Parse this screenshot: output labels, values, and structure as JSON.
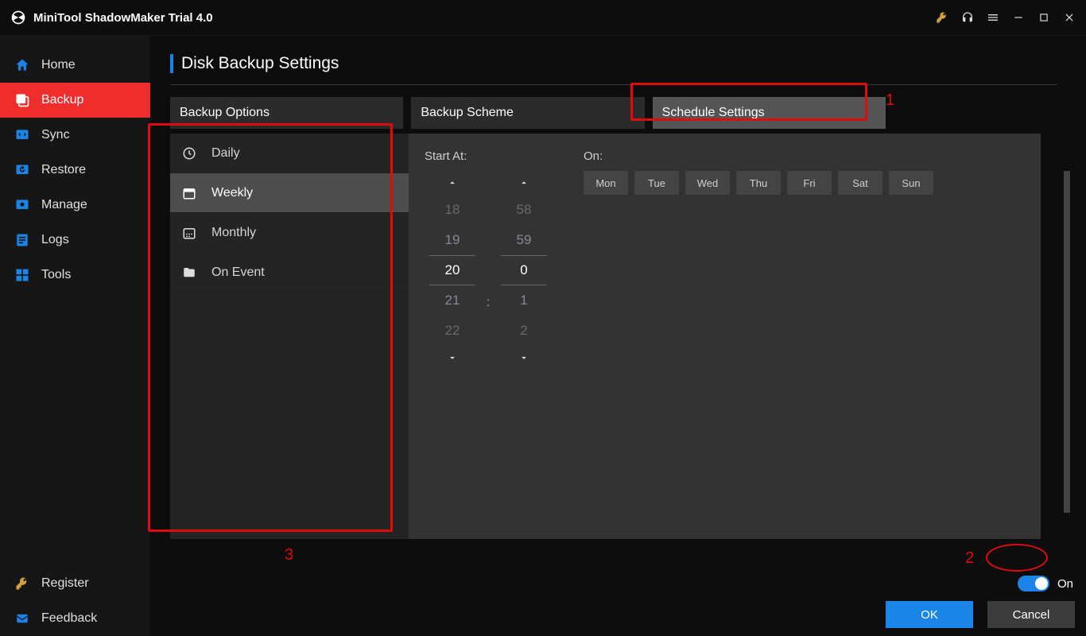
{
  "app": {
    "title": "MiniTool ShadowMaker Trial 4.0"
  },
  "titlebar_icons": [
    "key-icon",
    "headset-icon",
    "menu-icon",
    "minimize-icon",
    "maximize-icon",
    "close-icon"
  ],
  "sidebar": {
    "items": [
      {
        "label": "Home",
        "icon": "home-icon",
        "active": false
      },
      {
        "label": "Backup",
        "icon": "backup-icon",
        "active": true
      },
      {
        "label": "Sync",
        "icon": "sync-icon",
        "active": false
      },
      {
        "label": "Restore",
        "icon": "restore-icon",
        "active": false
      },
      {
        "label": "Manage",
        "icon": "manage-icon",
        "active": false
      },
      {
        "label": "Logs",
        "icon": "logs-icon",
        "active": false
      },
      {
        "label": "Tools",
        "icon": "tools-icon",
        "active": false
      }
    ],
    "bottom": [
      {
        "label": "Register",
        "icon": "key-icon"
      },
      {
        "label": "Feedback",
        "icon": "mail-icon"
      }
    ]
  },
  "page": {
    "title": "Disk Backup Settings"
  },
  "tabs": [
    {
      "label": "Backup Options",
      "active": false
    },
    {
      "label": "Backup Scheme",
      "active": false
    },
    {
      "label": "Schedule Settings",
      "active": true
    }
  ],
  "frequency": {
    "items": [
      {
        "label": "Daily",
        "icon": "clock-icon",
        "active": false
      },
      {
        "label": "Weekly",
        "icon": "calendar-week-icon",
        "active": true
      },
      {
        "label": "Monthly",
        "icon": "calendar-month-icon",
        "active": false
      },
      {
        "label": "On Event",
        "icon": "folder-icon",
        "active": false
      }
    ]
  },
  "schedule": {
    "start_label": "Start At:",
    "on_label": "On:",
    "hours": {
      "vals": [
        "18",
        "19",
        "20",
        "21",
        "22"
      ],
      "selected_index": 2
    },
    "minutes": {
      "vals": [
        "58",
        "59",
        "0",
        "1",
        "2"
      ],
      "selected_index": 2
    },
    "separator": ":",
    "days": [
      "Mon",
      "Tue",
      "Wed",
      "Thu",
      "Fri",
      "Sat",
      "Sun"
    ]
  },
  "toggle": {
    "state": "on",
    "label": "On"
  },
  "buttons": {
    "ok": "OK",
    "cancel": "Cancel"
  },
  "annotations": {
    "n1": "1",
    "n2": "2",
    "n3": "3"
  }
}
